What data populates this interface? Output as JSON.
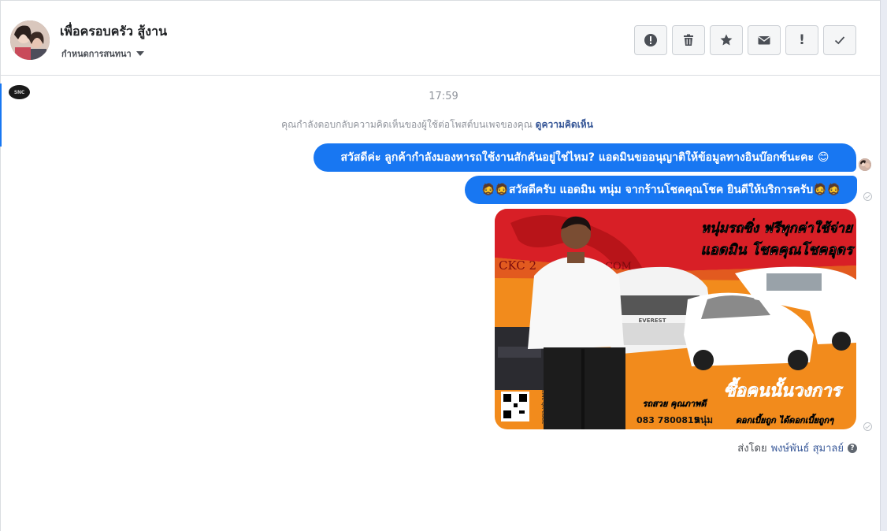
{
  "header": {
    "contact_name": "เพื่อครอบครัว สู้งาน",
    "assign_label": "กำหนดการสนทนา"
  },
  "actions": [
    {
      "name": "spam",
      "icon": "alert-circle-icon"
    },
    {
      "name": "delete",
      "icon": "trash-icon"
    },
    {
      "name": "star",
      "icon": "star-icon"
    },
    {
      "name": "unread",
      "icon": "envelope-icon"
    },
    {
      "name": "follow-up",
      "icon": "exclamation-icon",
      "label": "!"
    },
    {
      "name": "done",
      "icon": "check-icon"
    }
  ],
  "page_logo_text": "SNC",
  "conversation": {
    "time": "17:59",
    "notice_text": "คุณกำลังตอบกลับความคิดเห็นของผู้ใช้ต่อโพสต์บนเพจของคุณ",
    "notice_link": "ดูความคิดเห็น",
    "messages": [
      {
        "text": "สวัสดีค่ะ ลูกค้ากำลังมองหารถใช้งานสักคันอยู่ใช่ไหม? แอดมินขออนุญาติให้ข้อมูลทางอินบ๊อกซ์นะคะ 😊"
      },
      {
        "text": "🧔🧔สวัสดีครับ แอดมิน หนุ่ม จากร้านโชคคุณโชค ยินดีให้บริการครับ🧔🧔"
      }
    ],
    "image": {
      "headline_1": "หนุ่มรถซิ่ง ฟรีทุกค่าใช้จ่าย",
      "headline_2": "แอดมิน โชคคุณโชคอุดร",
      "brand": "CKC 2",
      "brand_tail": "COM",
      "slogan": "ซื้อคนนั้นวงการ",
      "quality": "รถสวย คุณภาพดี",
      "phone": "083 7800815",
      "phone_name": "หนุ่ม",
      "promo": "ดอกเบี้ยถูก ได้ดอกเบี้ยถูกๆ",
      "line_label": "LINE QR CODE",
      "car_badge": "EVEREST"
    },
    "sent_by_label": "ส่งโดย",
    "sent_by_name": "พงษ์พันธ์ สุมาลย์",
    "help_glyph": "?"
  },
  "colors": {
    "bubble": "#1877f2",
    "link": "#385898",
    "muted": "#90949c",
    "image_red": "#d81f26",
    "image_orange": "#f28b1c"
  }
}
